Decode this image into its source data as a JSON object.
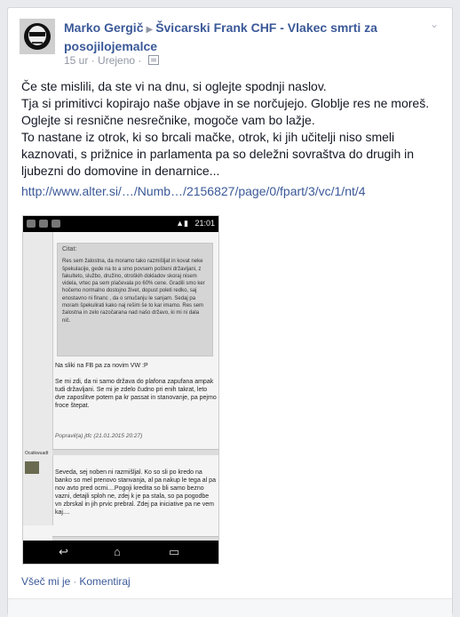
{
  "post": {
    "author": "Marko Gergič",
    "group": "Švicarski Frank CHF - Vlakec smrti za posojilojemalce",
    "time": "15 ur",
    "edited": "Urejeno",
    "privacy_icon": "audience-icon",
    "lines": [
      "Če ste mislili, da ste vi na dnu, si oglejte spodnji naslov.",
      "Tja si primitivci kopirajo naše objave in se norčujejo. Globlje res ne moreš.",
      "Oglejte si resnične nesrečnike, mogoče vam bo lažje.",
      "To nastane iz otrok, ki so brcali mačke, otrok, ki jih učitelji niso smeli",
      "kaznovati, s prižnice in parlamenta pa so deležni sovraštva do drugih in",
      "ljubezni do domovine in denarnice..."
    ],
    "link": "http://www.alter.si/…/Numb…/2156827/page/0/fpart/3/vc/1/nt/4"
  },
  "screenshot": {
    "citat_label": "Citat:",
    "citat_text": "Res sem žalostna, da moramo tako razmišljat in kovat neke špekulacije, gede na to a smo povsem pošteni državljani, z fakulteto, službo, družino, otroških dokladov skoraj nisem videla, vrtec pa sem plačevala po 60% cene. Gradili smo ker hočemo normalno dostojno živet, dopust poleti redko, saj enostavno ni financ , da o smučanju le sanjam. Sedaj pa moram špekulirati kako naj rešim še to kar imamo. Res sem žalostna in zelo razočarana nad našo državo, ki mi ni dala nič.",
    "reply1_a": "Na sliki na FB pa za novim VW :P",
    "reply1_b": "Se mi zdi, da ni samo država do plafona zapufana ampak tudi državljani. Se mi je zdelo čudno pri enih takrat, leto dve zaposlitve potem pa kr passat in stanovanje, pa pejmo froce štepat.",
    "popravil": "Popravil(a) jtfc (21.01.2015 20:27)",
    "reply2": "Seveda, sej noben ni razmišljal. Ko so sli po kredo na banko so mel prenovo stanvanja, al pa nakup le tega al pa nov avto pred ocmi....Pogoji kredita so bli samo bezno vazni, detajli sploh ne, zdej k je pa stala, so pa pogodbe vn zbrskal in jih prvic prebral. Zdej pa iniciative pa ne vem kaj....",
    "nick": "Ocatkwuadt",
    "time": "21:01"
  },
  "footer": {
    "like": "Všeč mi je",
    "comment": "Komentiraj"
  }
}
